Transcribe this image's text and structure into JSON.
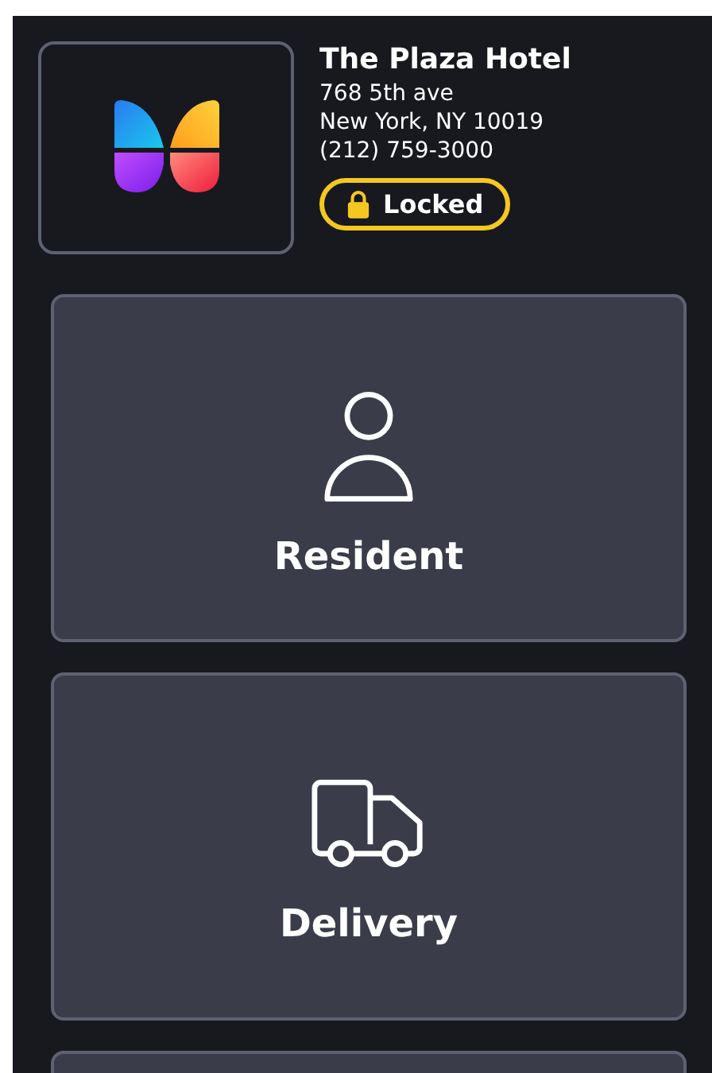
{
  "property": {
    "name": "The Plaza Hotel",
    "address_lines": [
      "768 5th ave",
      "New York, NY 10019",
      "(212) 759-3000"
    ]
  },
  "status": {
    "label": "Locked",
    "locked": true
  },
  "cards": [
    {
      "kind": "resident",
      "label": "Resident"
    },
    {
      "kind": "delivery",
      "label": "Delivery"
    },
    {
      "kind": "blank"
    }
  ]
}
